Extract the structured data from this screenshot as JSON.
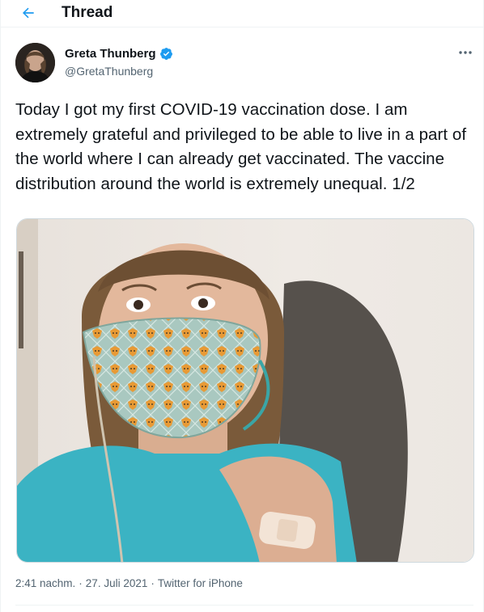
{
  "header": {
    "title": "Thread"
  },
  "tweet": {
    "author": {
      "name": "Greta Thunberg",
      "handle": "@GretaThunberg",
      "verified": true
    },
    "text": "Today I got my first COVID-19 vaccination dose. I am extremely grateful and privileged to be able to live in a part of the world where I can already get vaccinated. The vaccine distribution around the world is extremely unequal. 1/2",
    "meta": {
      "time": "2:41 nachm.",
      "separator": "·",
      "date": "27. Juli 2021",
      "source": "Twitter for iPhone"
    }
  },
  "colors": {
    "accent": "#1d9bf0",
    "text_primary": "#0f1419",
    "text_secondary": "#536471",
    "border": "#eff3f4"
  },
  "icons": {
    "back": "arrow-left-icon",
    "verified": "verified-badge-icon",
    "more": "more-horizontal-icon"
  }
}
